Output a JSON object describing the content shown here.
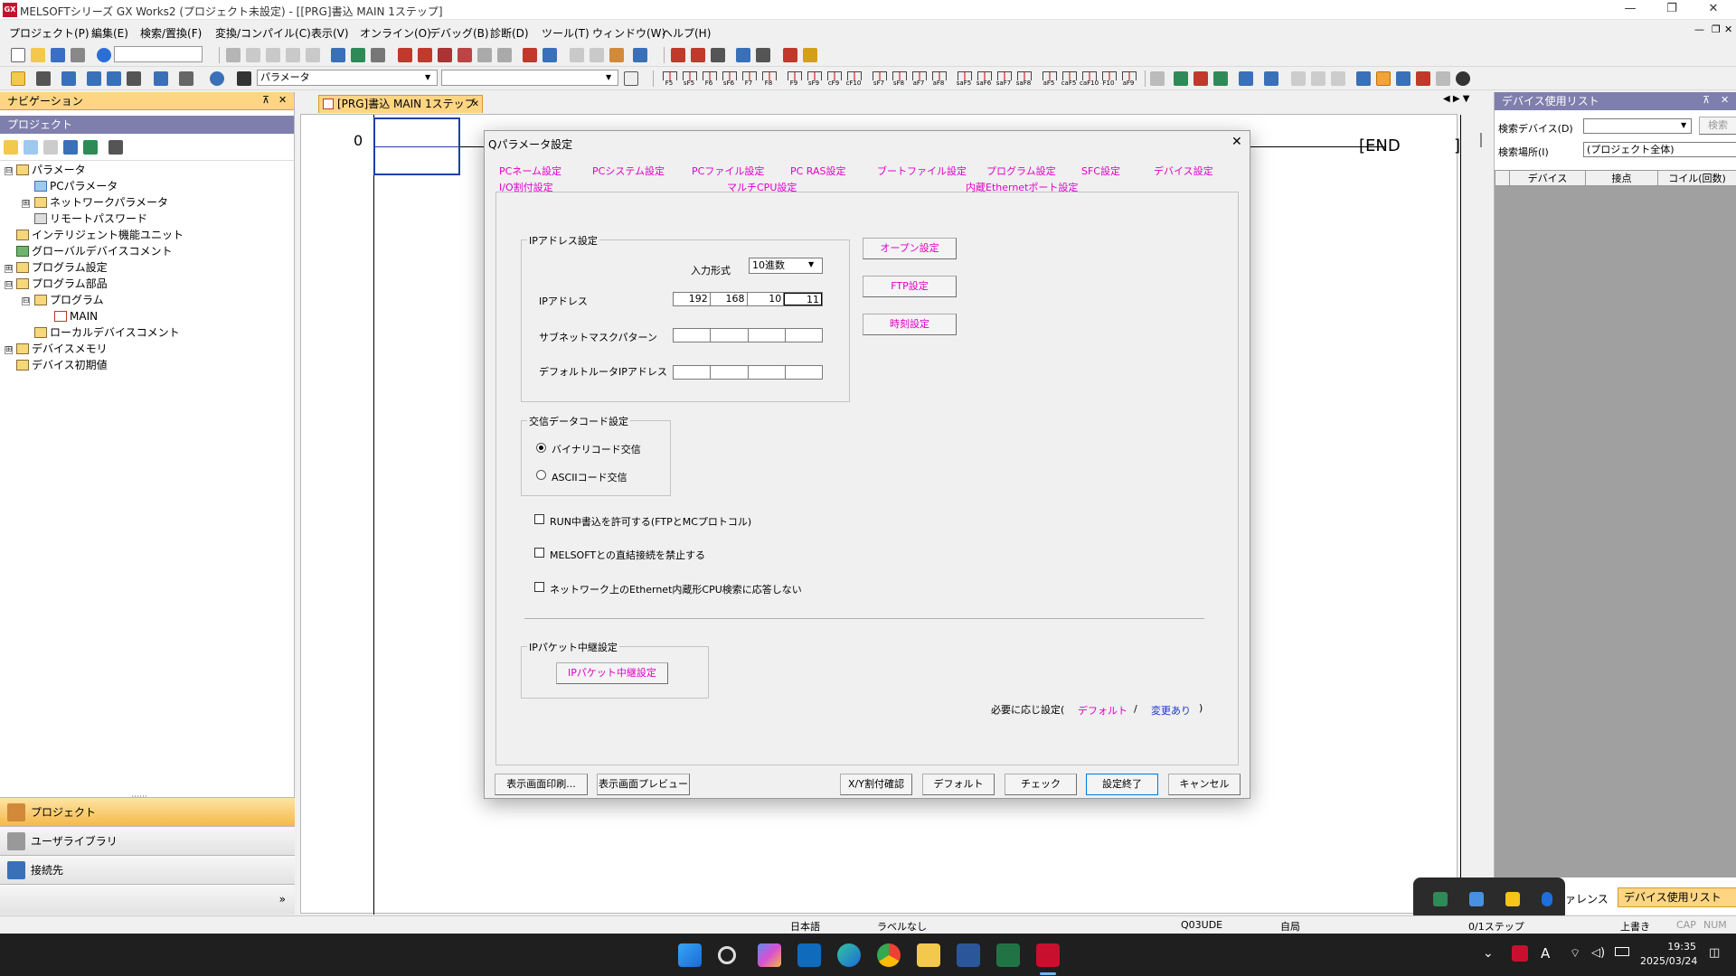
{
  "titlebar": {
    "title": "MELSOFTシリーズ GX Works2 (プロジェクト未設定) - [[PRG]書込 MAIN 1ステップ]",
    "app_icon": "GX",
    "buttons": [
      "minimize",
      "maximize",
      "close"
    ]
  },
  "menu": [
    "プロジェクト(P)",
    "編集(E)",
    "検索/置換(F)",
    "変換/コンパイル(C)",
    "表示(V)",
    "オンライン(O)",
    "デバッグ(B)",
    "診断(D)",
    "ツール(T)",
    "ウィンドウ(W)",
    "ヘルプ(H)"
  ],
  "toolbar2": {
    "param_combo": "パラメータ"
  },
  "fkeys": [
    "F5",
    "sF5",
    "F6",
    "sF6",
    "F7",
    "F8",
    "F9",
    "sF9",
    "cF9",
    "cF10",
    "sF7",
    "sF8",
    "aF7",
    "aF8",
    "saF5",
    "saF6",
    "saF7",
    "saF8",
    "aF5",
    "caF5",
    "caF10",
    "F10",
    "aF9"
  ],
  "navigation": {
    "header": "ナビゲーション",
    "pin": "ᵖ",
    "close": "✕",
    "project_header": "プロジェクト",
    "tree": [
      {
        "label": "パラメータ",
        "level": 0,
        "exp": "⊟"
      },
      {
        "label": "PCパラメータ",
        "level": 1,
        "exp": ""
      },
      {
        "label": "ネットワークパラメータ",
        "level": 1,
        "exp": "⊞"
      },
      {
        "label": "リモートパスワード",
        "level": 1,
        "exp": ""
      },
      {
        "label": "インテリジェント機能ユニット",
        "level": 0,
        "exp": ""
      },
      {
        "label": "グローバルデバイスコメント",
        "level": 0,
        "exp": ""
      },
      {
        "label": "プログラム設定",
        "level": 0,
        "exp": "⊞"
      },
      {
        "label": "プログラム部品",
        "level": 0,
        "exp": "⊟"
      },
      {
        "label": "プログラム",
        "level": 1,
        "exp": "⊟"
      },
      {
        "label": "MAIN",
        "level": 2,
        "exp": ""
      },
      {
        "label": "ローカルデバイスコメント",
        "level": 1,
        "exp": ""
      },
      {
        "label": "デバイスメモリ",
        "level": 0,
        "exp": "⊞"
      },
      {
        "label": "デバイス初期値",
        "level": 0,
        "exp": ""
      }
    ],
    "bottom_buttons": [
      "プロジェクト",
      "ユーザライブラリ",
      "接続先"
    ],
    "more": "»"
  },
  "editor": {
    "tab": "[PRG]書込 MAIN 1ステップ",
    "step": "0",
    "end": "END"
  },
  "dialog": {
    "title": "Qパラメータ設定",
    "close": "✕",
    "tabs_row1": [
      "PCネーム設定",
      "PCシステム設定",
      "PCファイル設定",
      "PC RAS設定",
      "ブートファイル設定",
      "プログラム設定",
      "SFC設定",
      "デバイス設定"
    ],
    "tabs_row2": [
      "I/O割付設定",
      "マルチCPU設定",
      "内蔵Ethernetポート設定"
    ],
    "ip_group": {
      "title": "IPアドレス設定",
      "input_format_label": "入力形式",
      "input_format_value": "10進数",
      "ip_label": "IPアドレス",
      "ip": [
        "192",
        "168",
        "10",
        "11"
      ],
      "subnet_label": "サブネットマスクパターン",
      "subnet": [
        "",
        "",
        "",
        ""
      ],
      "gateway_label": "デフォルトルータIPアドレス",
      "gateway": [
        "",
        "",
        "",
        ""
      ]
    },
    "side_buttons": [
      "オープン設定",
      "FTP設定",
      "時刻設定"
    ],
    "code_group": {
      "title": "交信データコード設定",
      "binary": "バイナリコード交信",
      "ascii": "ASCIIコード交信"
    },
    "checks": [
      "RUN中書込を許可する(FTPとMCプロトコル)",
      "MELSOFTとの直結接続を禁止する",
      "ネットワーク上のEthernet内蔵形CPU検索に応答しない"
    ],
    "relay_group": {
      "title": "IPパケット中継設定",
      "button": "IPパケット中継設定"
    },
    "legend": {
      "prefix": "必要に応じ設定(",
      "default": "デフォルト",
      "slash": "/",
      "changed": "変更あり",
      "suffix": ")"
    },
    "footer_buttons": [
      "表示画面印刷...",
      "表示画面プレビュー",
      "X/Y割付確認",
      "デフォルト",
      "チェック",
      "設定終了",
      "キャンセル"
    ]
  },
  "devlist": {
    "header": "デバイス使用リスト",
    "search_device_label": "検索デバイス(D)",
    "search_btn": "検索",
    "search_place_label": "検索場所(I)",
    "search_place_value": "(プロジェクト全体)",
    "columns": [
      "デバイス",
      "接点",
      "コイル(回数)"
    ],
    "bottom_tabs": [
      "ファレンス",
      "デバイス使用リスト"
    ]
  },
  "status": {
    "lang": "日本語",
    "label": "ラベルなし",
    "cpu": "Q03UDE",
    "station": "自局",
    "steps": "0/1ステップ",
    "mode": "上書き",
    "cap": "CAP",
    "num": "NUM"
  },
  "taskbar": {
    "time": "19:35",
    "date": "2025/03/24",
    "ime": "A"
  }
}
